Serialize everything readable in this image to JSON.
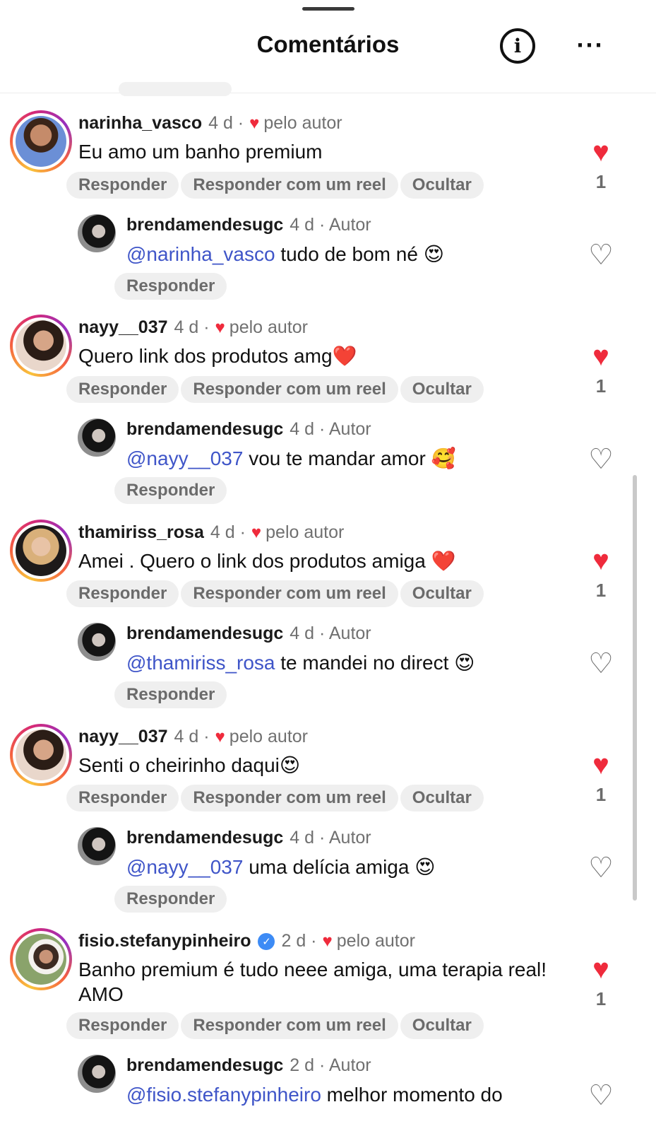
{
  "header": {
    "title": "Comentários",
    "info_icon": "info-circle-icon",
    "more_icon": "more-horizontal-icon",
    "more_glyph": "···"
  },
  "labels": {
    "reply": "Responder",
    "reply_reel": "Responder com um reel",
    "hide": "Ocultar",
    "liked_by_author": "pelo autor",
    "author_badge": "Autor"
  },
  "comments": [
    {
      "username": "narinha_vasco",
      "time": "4 d ·",
      "text": "Eu amo um banho premium",
      "likes": "1",
      "liked": true,
      "reply": {
        "username": "brendamendesugc",
        "time": "4 d · Autor",
        "mention": "@narinha_vasco",
        "text": " tudo de bom né 😍",
        "liked": false
      }
    },
    {
      "username": "nayy__037",
      "time": "4 d ·",
      "text": "Quero link dos produtos amg❤️",
      "likes": "1",
      "liked": true,
      "reply": {
        "username": "brendamendesugc",
        "time": "4 d · Autor",
        "mention": "@nayy__037",
        "text": " vou te mandar amor 🥰",
        "liked": false
      }
    },
    {
      "username": "thamiriss_rosa",
      "time": "4 d ·",
      "text": "Amei . Quero o link dos produtos amiga ❤️",
      "likes": "1",
      "liked": true,
      "reply": {
        "username": "brendamendesugc",
        "time": "4 d · Autor",
        "mention": "@thamiriss_rosa",
        "text": " te mandei no direct 😍",
        "liked": false
      }
    },
    {
      "username": "nayy__037",
      "time": "4 d ·",
      "text": "Senti o cheirinho daqui😍",
      "likes": "1",
      "liked": true,
      "reply": {
        "username": "brendamendesugc",
        "time": "4 d · Autor",
        "mention": "@nayy__037",
        "text": " uma delícia amiga 😍",
        "liked": false
      }
    },
    {
      "username": "fisio.stefanypinheiro",
      "verified": true,
      "time": "2 d ·",
      "text": "Banho premium é tudo neee amiga, uma terapia real! AMO",
      "likes": "1",
      "liked": true,
      "reply": {
        "username": "brendamendesugc",
        "time": "2 d · Autor",
        "mention": "@fisio.stefanypinheiro",
        "text": " melhor momento do",
        "liked": false
      }
    }
  ],
  "colors": {
    "like_red": "#ef2b3c",
    "mention_blue": "#3f55c8",
    "pill_bg": "#efefef",
    "meta_gray": "#707070"
  }
}
